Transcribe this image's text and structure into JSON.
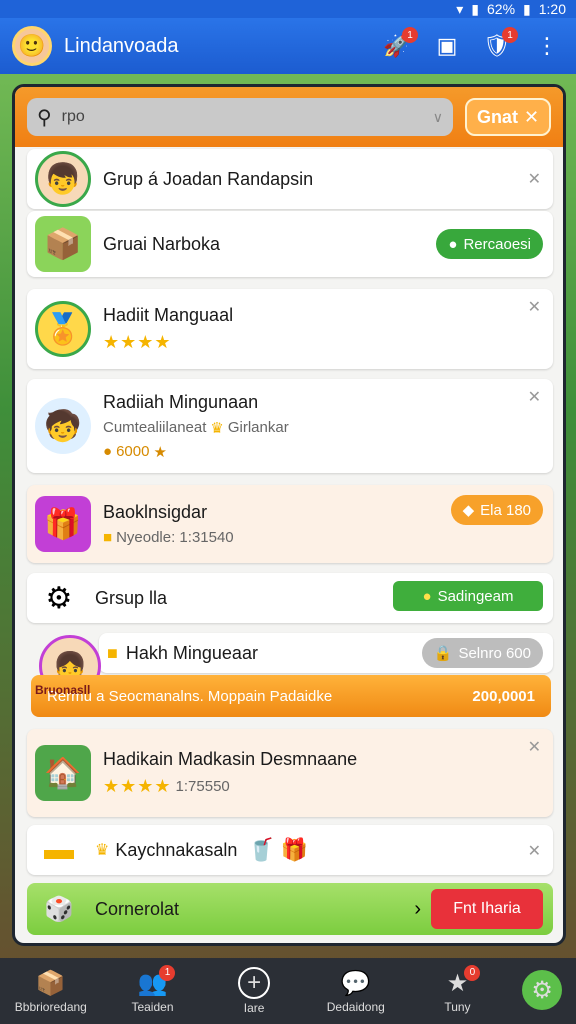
{
  "status_bar": {
    "battery": "62%",
    "time": "1:20"
  },
  "app_bar": {
    "title": "Lindanvoada",
    "badges": [
      "1",
      "1"
    ]
  },
  "search": {
    "placeholder": "rpo",
    "button_label": "Gnat"
  },
  "rows": [
    {
      "title": "Grup á Joadan Randapsin"
    },
    {
      "title": "Gruai Narboka",
      "pill": "Rercaoesi"
    },
    {
      "title": "Hadiit Manguaal",
      "stars": "★★★★"
    },
    {
      "title": "Radiiah Mingunaan",
      "sub1": "Cumtealiilaneat",
      "sub2": "Girlankar",
      "sub3": "6000"
    },
    {
      "title": "Baoklnsigdar",
      "sub": "Nyeodle: 1:31540",
      "pill": "Ela  180"
    },
    {
      "title": "Grsup lla",
      "pill": "Sadingeam"
    },
    {
      "title": "Hakh Mingueaar",
      "pill": "Selnro  600",
      "avatar_label": "Bruonasll"
    },
    {
      "banner": "Rermu a Seocmanalns. Moppain Padaidke",
      "amount": "200,0001"
    },
    {
      "title": "Hadikain Madkasin Desmnaane",
      "stars": "★★★★",
      "sub": "1:75550"
    },
    {
      "title": "Kaychnakasaln"
    },
    {
      "title": "Cornerolat",
      "action": "Fnt Iharia"
    }
  ],
  "nav": [
    {
      "label": "Bbbrioredang"
    },
    {
      "label": "Teaiden",
      "badge": "1"
    },
    {
      "label": "Iare"
    },
    {
      "label": "Dedaidong"
    },
    {
      "label": "Tuny",
      "badge": "0"
    }
  ]
}
